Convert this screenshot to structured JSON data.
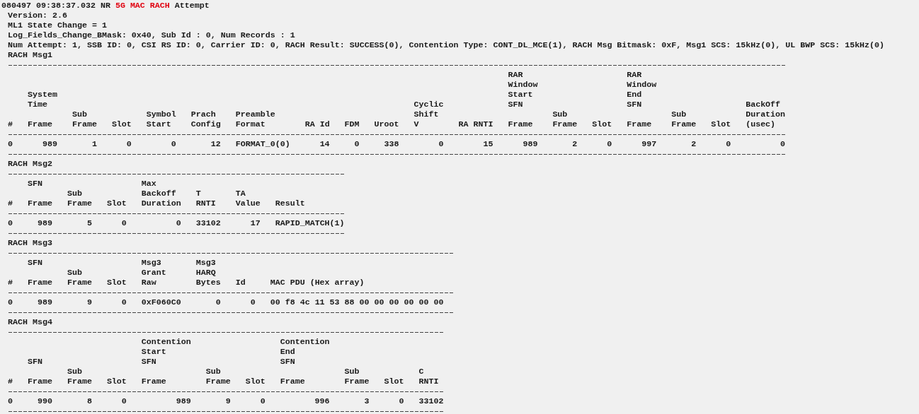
{
  "log_header": {
    "parts": [
      {
        "text": "080497 09:38:37.032 NR",
        "highlight": false
      },
      {
        "text": "5G MAC RACH",
        "highlight": true
      },
      {
        "text": "Attempt",
        "highlight": false
      }
    ]
  },
  "info_lines": [
    "Version: 2.6",
    "ML1 State Change = 1",
    "Log_Fields_Change_BMask: 0x40, Sub Id : 0, Num Records : 1",
    "Num Attempt: 1, SSB ID: 0, CSI RS ID: 0, Carrier ID: 0, RACH Result: SUCCESS(0), Contention Type: CONT_DL_MCE(1), RACH Msg Bitmask: 0xF, Msg1 SCS: 15kHz(0), UL BWP SCS: 15kHz(0)"
  ],
  "sections": [
    {
      "title": "RACH Msg1",
      "columns": [
        {
          "header": [
            "#"
          ],
          "kind": "text"
        },
        {
          "group": [
            "System",
            "Time"
          ],
          "header": [
            "Frame"
          ],
          "kind": "number"
        },
        {
          "header": [
            "Sub",
            "Frame"
          ],
          "kind": "number"
        },
        {
          "header": [
            "Slot"
          ],
          "kind": "number"
        },
        {
          "header": [
            "Symbol",
            "Start"
          ],
          "kind": "number"
        },
        {
          "header": [
            "Prach",
            "Config"
          ],
          "kind": "number"
        },
        {
          "header": [
            "Preamble",
            "Format"
          ],
          "kind": "text"
        },
        {
          "header": [
            "RA Id"
          ],
          "kind": "number"
        },
        {
          "header": [
            "FDM"
          ],
          "kind": "number"
        },
        {
          "header": [
            "Uroot"
          ],
          "kind": "number"
        },
        {
          "header": [
            "Cyclic",
            "Shift",
            "V"
          ],
          "kind": "number"
        },
        {
          "header": [
            "RA RNTI"
          ],
          "kind": "number"
        },
        {
          "group": [
            "RAR",
            "Window",
            "Start",
            "SFN"
          ],
          "header": [
            "Frame"
          ],
          "kind": "number"
        },
        {
          "header": [
            "Sub",
            "Frame"
          ],
          "kind": "number"
        },
        {
          "header": [
            "Slot"
          ],
          "kind": "number"
        },
        {
          "group": [
            "RAR",
            "Window",
            "End",
            "SFN"
          ],
          "header": [
            "Frame"
          ],
          "kind": "number"
        },
        {
          "header": [
            "Sub",
            "Frame"
          ],
          "kind": "number"
        },
        {
          "header": [
            "Slot"
          ],
          "kind": "number"
        },
        {
          "header": [
            "BackOff",
            "Duration",
            "(usec)"
          ],
          "kind": "number"
        }
      ],
      "rows": [
        [
          "0",
          "989",
          "1",
          "0",
          "0",
          "12",
          "FORMAT_0(0)",
          "14",
          "0",
          "338",
          "0",
          "15",
          "989",
          "2",
          "0",
          "997",
          "2",
          "0",
          "0"
        ]
      ]
    },
    {
      "title": "RACH Msg2",
      "columns": [
        {
          "header": [
            "#"
          ],
          "kind": "text"
        },
        {
          "group": [
            "SFN"
          ],
          "header": [
            "Frame"
          ],
          "kind": "number"
        },
        {
          "header": [
            "Sub",
            "Frame"
          ],
          "kind": "number"
        },
        {
          "header": [
            "Slot"
          ],
          "kind": "number"
        },
        {
          "header": [
            "Max",
            "Backoff",
            "Duration"
          ],
          "kind": "number"
        },
        {
          "header": [
            "T",
            "RNTI"
          ],
          "kind": "text"
        },
        {
          "header": [
            "TA",
            "Value"
          ],
          "kind": "number"
        },
        {
          "header": [
            "Result"
          ],
          "kind": "text"
        }
      ],
      "rows": [
        [
          "0",
          "989",
          "5",
          "0",
          "0",
          "33102",
          "17",
          "RAPID_MATCH(1)"
        ]
      ]
    },
    {
      "title": "RACH Msg3",
      "columns": [
        {
          "header": [
            "#"
          ],
          "kind": "text"
        },
        {
          "group": [
            "SFN"
          ],
          "header": [
            "Frame"
          ],
          "kind": "number"
        },
        {
          "header": [
            "Sub",
            "Frame"
          ],
          "kind": "number"
        },
        {
          "header": [
            "Slot"
          ],
          "kind": "number"
        },
        {
          "header": [
            "Msg3",
            "Grant",
            "Raw"
          ],
          "kind": "text"
        },
        {
          "header": [
            "Msg3",
            "HARQ",
            "Bytes"
          ],
          "kind": "number"
        },
        {
          "header": [
            "Id"
          ],
          "kind": "number"
        },
        {
          "header": [
            "MAC PDU (Hex array)"
          ],
          "kind": "text"
        }
      ],
      "rows": [
        [
          "0",
          "989",
          "9",
          "0",
          "0xF060C0",
          "0",
          "0",
          "00 f8 4c 11 53 88 00 00 00 00 00 00"
        ]
      ]
    },
    {
      "title": "RACH Msg4",
      "columns": [
        {
          "header": [
            "#"
          ],
          "kind": "text"
        },
        {
          "group": [
            "SFN"
          ],
          "header": [
            "Frame"
          ],
          "kind": "number"
        },
        {
          "header": [
            "Sub",
            "Frame"
          ],
          "kind": "number"
        },
        {
          "header": [
            "Slot"
          ],
          "kind": "number"
        },
        {
          "group": [
            "Contention",
            "Start",
            "SFN"
          ],
          "header": [
            "Frame"
          ],
          "kind": "number"
        },
        {
          "header": [
            "Sub",
            "Frame"
          ],
          "kind": "number"
        },
        {
          "header": [
            "Slot"
          ],
          "kind": "number"
        },
        {
          "group": [
            "Contention",
            "End",
            "SFN"
          ],
          "header": [
            "Frame"
          ],
          "kind": "number"
        },
        {
          "header": [
            "Sub",
            "Frame"
          ],
          "kind": "number"
        },
        {
          "header": [
            "Slot"
          ],
          "kind": "number"
        },
        {
          "header": [
            "C",
            "RNTI"
          ],
          "kind": "text"
        }
      ],
      "rows": [
        [
          "0",
          "990",
          "8",
          "0",
          "989",
          "9",
          "0",
          "996",
          "3",
          "0",
          "33102"
        ]
      ]
    }
  ]
}
